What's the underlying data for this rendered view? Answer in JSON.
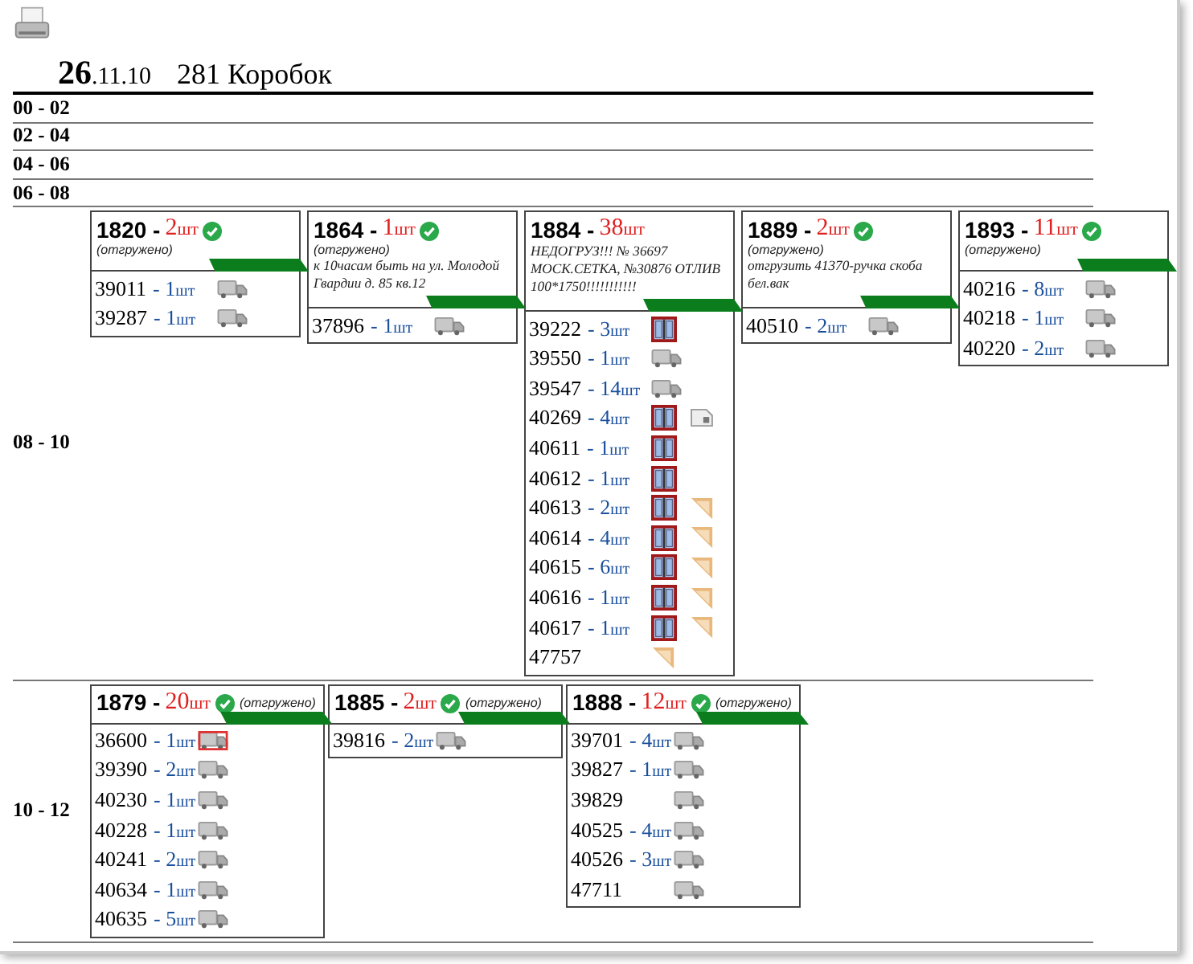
{
  "header": {
    "day": "26",
    "month_year": ".11.10",
    "boxes": "281 Коробок"
  },
  "slots": [
    {
      "label": "00 - 02"
    },
    {
      "label": "02 - 04"
    },
    {
      "label": "04 - 06"
    },
    {
      "label": "06 - 08"
    },
    {
      "label": "08 - 10",
      "orders": [
        {
          "kind": "full",
          "number": "1820 -",
          "qty": "2",
          "unit": "шт",
          "shipped": true,
          "status": "(отгружено)",
          "items": [
            {
              "code": "39011",
              "qty": "- 1",
              "unit": "шт",
              "icons": [
                {
                  "kind": "truck"
                }
              ],
              "highlighted": false
            },
            {
              "code": "39287",
              "qty": "- 1",
              "unit": "шт",
              "icons": [
                {
                  "kind": "truck"
                }
              ],
              "highlighted": false
            }
          ]
        },
        {
          "kind": "full",
          "number": "1864 -",
          "qty": "1",
          "unit": "шт",
          "shipped": true,
          "status": "(отгружено)",
          "note": "к 10часам быть на ул. Молодой Гвардии д. 85 кв.12",
          "items": [
            {
              "code": "37896",
              "qty": "- 1",
              "unit": "шт",
              "icons": [
                {
                  "kind": "truck"
                }
              ],
              "highlighted": false
            }
          ]
        },
        {
          "kind": "full",
          "number": "1884 -",
          "qty": "38",
          "unit": "шт",
          "shipped": false,
          "note": "НЕДОГРУЗ!!! № 36697 МОСК.СЕТКА, №30876 ОТЛИВ 100*1750!!!!!!!!!!!",
          "items": [
            {
              "code": "39222",
              "qty": "- 3",
              "unit": "шт",
              "icons": [
                {
                  "kind": "window"
                }
              ],
              "highlighted": false
            },
            {
              "code": "39550",
              "qty": "- 1",
              "unit": "шт",
              "icons": [
                {
                  "kind": "truck"
                }
              ],
              "highlighted": false
            },
            {
              "code": "39547",
              "qty": "- 14",
              "unit": "шт",
              "icons": [
                {
                  "kind": "truck"
                }
              ],
              "highlighted": false
            },
            {
              "code": "40269",
              "qty": "- 4",
              "unit": "шт",
              "icons": [
                {
                  "kind": "window"
                },
                {
                  "kind": "sheet"
                }
              ],
              "highlighted": false
            },
            {
              "code": "40611",
              "qty": "- 1",
              "unit": "шт",
              "icons": [
                {
                  "kind": "window"
                }
              ],
              "highlighted": false
            },
            {
              "code": "40612",
              "qty": "- 1",
              "unit": "шт",
              "icons": [
                {
                  "kind": "window"
                }
              ],
              "highlighted": false
            },
            {
              "code": "40613",
              "qty": "- 2",
              "unit": "шт",
              "icons": [
                {
                  "kind": "window"
                },
                {
                  "kind": "corner"
                }
              ],
              "highlighted": false
            },
            {
              "code": "40614",
              "qty": "- 4",
              "unit": "шт",
              "icons": [
                {
                  "kind": "window"
                },
                {
                  "kind": "corner"
                }
              ],
              "highlighted": false
            },
            {
              "code": "40615",
              "qty": "- 6",
              "unit": "шт",
              "icons": [
                {
                  "kind": "window"
                },
                {
                  "kind": "corner"
                }
              ],
              "highlighted": false
            },
            {
              "code": "40616",
              "qty": "- 1",
              "unit": "шт",
              "icons": [
                {
                  "kind": "window"
                },
                {
                  "kind": "corner"
                }
              ],
              "highlighted": false
            },
            {
              "code": "40617",
              "qty": "- 1",
              "unit": "шт",
              "icons": [
                {
                  "kind": "window"
                },
                {
                  "kind": "corner"
                }
              ],
              "highlighted": false
            },
            {
              "code": "47757",
              "icons": [
                {
                  "kind": "corner"
                }
              ],
              "highlighted": false
            }
          ]
        },
        {
          "kind": "full",
          "number": "1889 -",
          "qty": "2",
          "unit": "шт",
          "shipped": true,
          "status": "(отгружено)",
          "note": "отгрузить 41370-ручка скоба бел.вак",
          "items": [
            {
              "code": "40510",
              "qty": "- 2",
              "unit": "шт",
              "icons": [
                {
                  "kind": "truck"
                }
              ],
              "highlighted": false
            }
          ]
        },
        {
          "kind": "full",
          "number": "1893 -",
          "qty": "11",
          "unit": "шт",
          "shipped": true,
          "status": "(отгружено)",
          "items": [
            {
              "code": "40216",
              "qty": "- 8",
              "unit": "шт",
              "icons": [
                {
                  "kind": "truck"
                }
              ],
              "highlighted": false
            },
            {
              "code": "40218",
              "qty": "- 1",
              "unit": "шт",
              "icons": [
                {
                  "kind": "truck"
                }
              ],
              "highlighted": false
            },
            {
              "code": "40220",
              "qty": "- 2",
              "unit": "шт",
              "icons": [
                {
                  "kind": "truck"
                }
              ],
              "highlighted": false
            }
          ]
        }
      ]
    },
    {
      "label": "10 - 12",
      "orders": [
        {
          "kind": "compact",
          "number": "1879 -",
          "qty": "20",
          "unit": "шт",
          "shipped": true,
          "status": "(отгружено)",
          "items": [
            {
              "code": "36600",
              "qty": "- 1",
              "unit": "шт",
              "icons": [
                {
                  "kind": "truck"
                }
              ],
              "highlighted": true
            },
            {
              "code": "39390",
              "qty": "- 2",
              "unit": "шт",
              "icons": [
                {
                  "kind": "truck"
                }
              ],
              "highlighted": false
            },
            {
              "code": "40230",
              "qty": "- 1",
              "unit": "шт",
              "icons": [
                {
                  "kind": "truck"
                }
              ],
              "highlighted": false
            },
            {
              "code": "40228",
              "qty": "- 1",
              "unit": "шт",
              "icons": [
                {
                  "kind": "truck"
                }
              ],
              "highlighted": false
            },
            {
              "code": "40241",
              "qty": "- 2",
              "unit": "шт",
              "icons": [
                {
                  "kind": "truck"
                }
              ],
              "highlighted": false
            },
            {
              "code": "40634",
              "qty": "- 1",
              "unit": "шт",
              "icons": [
                {
                  "kind": "truck"
                }
              ],
              "highlighted": false
            },
            {
              "code": "40635",
              "qty": "- 5",
              "unit": "шт",
              "icons": [
                {
                  "kind": "truck"
                }
              ],
              "highlighted": false
            }
          ]
        },
        {
          "kind": "compact",
          "number": "1885 -",
          "qty": "2",
          "unit": "шт",
          "shipped": true,
          "status": "(отгружено)",
          "items": [
            {
              "code": "39816",
              "qty": "- 2",
              "unit": "шт",
              "icons": [
                {
                  "kind": "truck"
                }
              ],
              "highlighted": false
            }
          ]
        },
        {
          "kind": "compact",
          "number": "1888 -",
          "qty": "12",
          "unit": "шт",
          "shipped": true,
          "status": "(отгружено)",
          "items": [
            {
              "code": "39701",
              "qty": "- 4",
              "unit": "шт",
              "icons": [
                {
                  "kind": "truck"
                }
              ],
              "highlighted": false
            },
            {
              "code": "39827",
              "qty": "- 1",
              "unit": "шт",
              "icons": [
                {
                  "kind": "truck"
                }
              ],
              "highlighted": false
            },
            {
              "code": "39829",
              "icons": [
                {
                  "kind": "truck"
                }
              ],
              "highlighted": false
            },
            {
              "code": "40525",
              "qty": "- 4",
              "unit": "шт",
              "icons": [
                {
                  "kind": "truck"
                }
              ],
              "highlighted": false
            },
            {
              "code": "40526",
              "qty": "- 3",
              "unit": "шт",
              "icons": [
                {
                  "kind": "truck"
                }
              ],
              "highlighted": false
            },
            {
              "code": "47711",
              "icons": [
                {
                  "kind": "truck"
                }
              ],
              "highlighted": false
            }
          ]
        }
      ]
    }
  ]
}
